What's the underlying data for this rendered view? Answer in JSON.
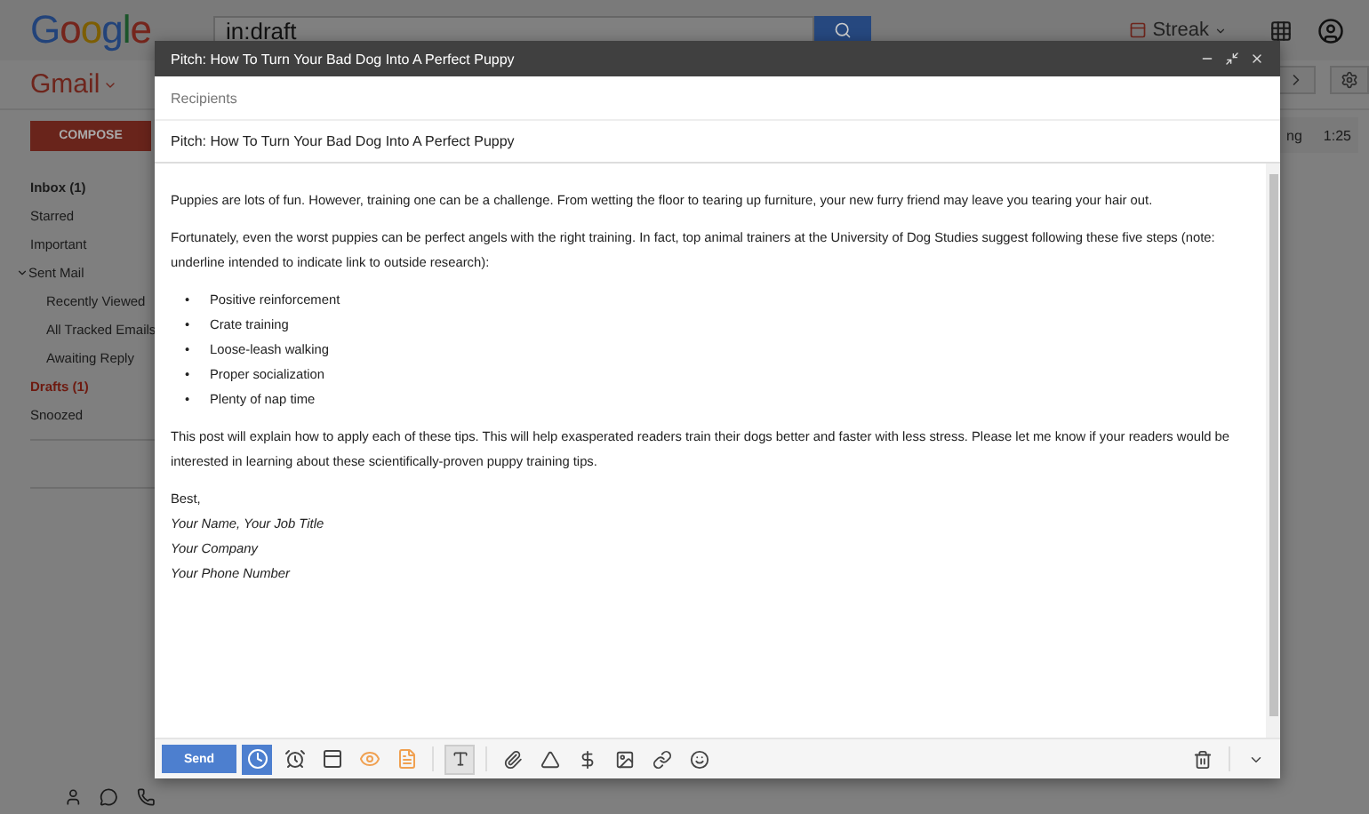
{
  "header": {
    "logo": "Google",
    "search": {
      "value": "in:draft"
    },
    "streak": "Streak"
  },
  "subbar": {
    "app": "Gmail"
  },
  "sidebar": {
    "compose": "COMPOSE",
    "items": [
      {
        "label": "Inbox (1)",
        "selected": false,
        "bold": true
      },
      {
        "label": "Starred",
        "selected": false,
        "bold": false
      },
      {
        "label": "Important",
        "selected": false,
        "bold": false
      },
      {
        "label": "Sent Mail",
        "selected": false,
        "bold": false,
        "expanded": true,
        "children": [
          {
            "label": "Recently Viewed",
            "selected": false,
            "bold": false
          },
          {
            "label": "All Tracked Emails",
            "selected": false,
            "bold": false
          },
          {
            "label": "Awaiting Reply",
            "selected": false,
            "bold": false
          }
        ]
      },
      {
        "label": "Drafts (1)",
        "selected": true,
        "bold": true
      },
      {
        "label": "Snoozed",
        "selected": false,
        "bold": false
      }
    ]
  },
  "list_row": {
    "snippet": "ng",
    "time": "1:25"
  },
  "compose": {
    "title": "Pitch: How To Turn Your Bad Dog Into A Perfect Puppy",
    "recipients": {
      "placeholder": "Recipients"
    },
    "subject": "Pitch: How To Turn Your Bad Dog Into A Perfect Puppy",
    "body": [
      {
        "kind": "paragraph",
        "text": "Puppies are lots of fun. However, training one can be a challenge. From wetting the floor to tearing up furniture, your new furry friend may leave you tearing your hair out."
      },
      {
        "kind": "paragraph",
        "text": "Fortunately, even the worst puppies can be perfect angels with the right training. In fact, top animal trainers at the University of Dog Studies suggest following these five steps (note: underline intended to indicate link to outside research):"
      },
      {
        "kind": "list",
        "bullet": "•",
        "items": [
          "Positive reinforcement",
          "Crate training",
          "Loose-leash walking",
          "Proper socialization",
          "Plenty of nap time"
        ]
      },
      {
        "kind": "paragraph",
        "text": "This post will explain how to apply each of these tips. This will help exasperated readers train their dogs better and faster with less stress. Please let me know if your readers would be interested in learning about these scientifically-proven puppy training tips."
      },
      {
        "kind": "signature",
        "closing": "Best,",
        "lines": [
          "Your Name, Your Job Title",
          "Your Company",
          "Your Phone Number"
        ]
      }
    ],
    "send": "Send",
    "format_pressed": true
  }
}
